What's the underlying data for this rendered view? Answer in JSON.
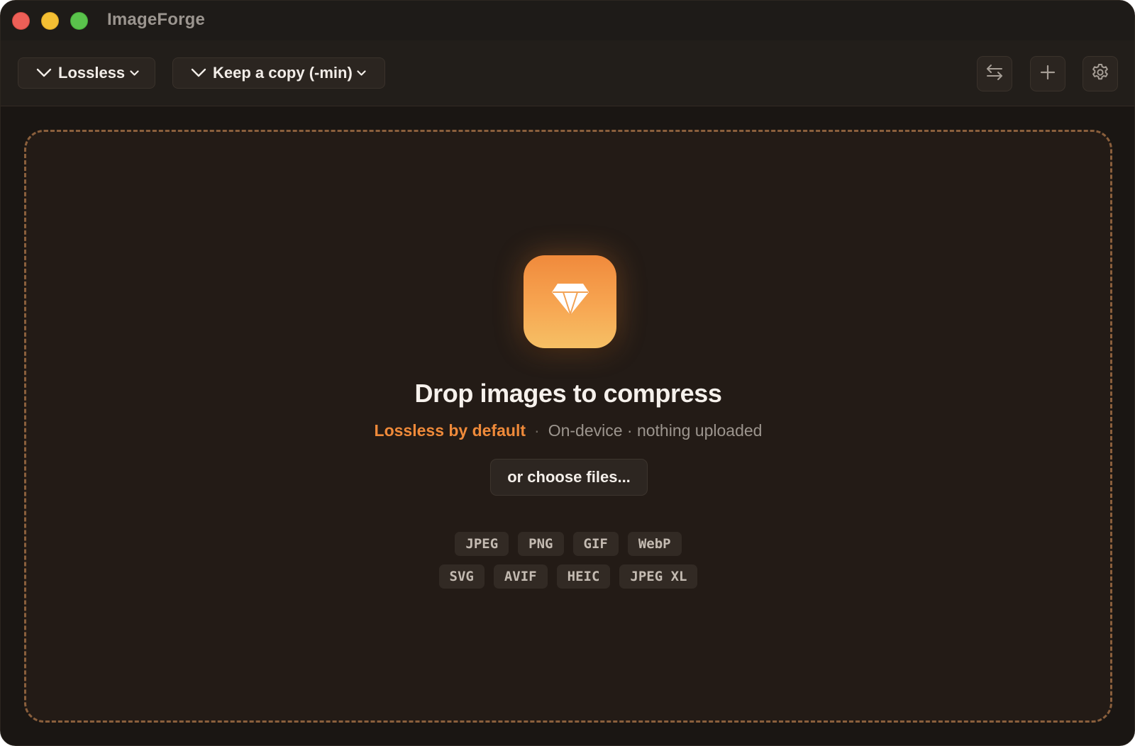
{
  "window": {
    "title": "ImageForge",
    "traffic_lights": [
      "close",
      "minimize",
      "maximize"
    ]
  },
  "toolbar": {
    "mode_dropdown": {
      "label": "Lossless",
      "icon": "chevron-down-icon"
    },
    "copy_dropdown": {
      "label": "Keep a copy (-min)",
      "icon": "chevron-down-icon"
    },
    "buttons": [
      {
        "name": "swap-button",
        "icon": "arrows-swap-icon"
      },
      {
        "name": "add-button",
        "icon": "plus-icon"
      },
      {
        "name": "settings-button",
        "icon": "gear-icon"
      }
    ]
  },
  "dropzone": {
    "icon": "diamond-icon",
    "headline": "Drop images to compress",
    "accent_text": "Lossless by default",
    "separator": "·",
    "info_text": "On-device · nothing uploaded",
    "choose_label": "or choose files...",
    "formats_row1": [
      "JPEG",
      "PNG",
      "GIF",
      "WebP"
    ],
    "formats_row2": [
      "SVG",
      "AVIF",
      "HEIC",
      "JPEG XL"
    ]
  },
  "colors": {
    "accent": "#ef8a3a",
    "background": "#1a1613",
    "dropzone_bg": "#231b16",
    "dashed_border": "#8a5f3c"
  }
}
